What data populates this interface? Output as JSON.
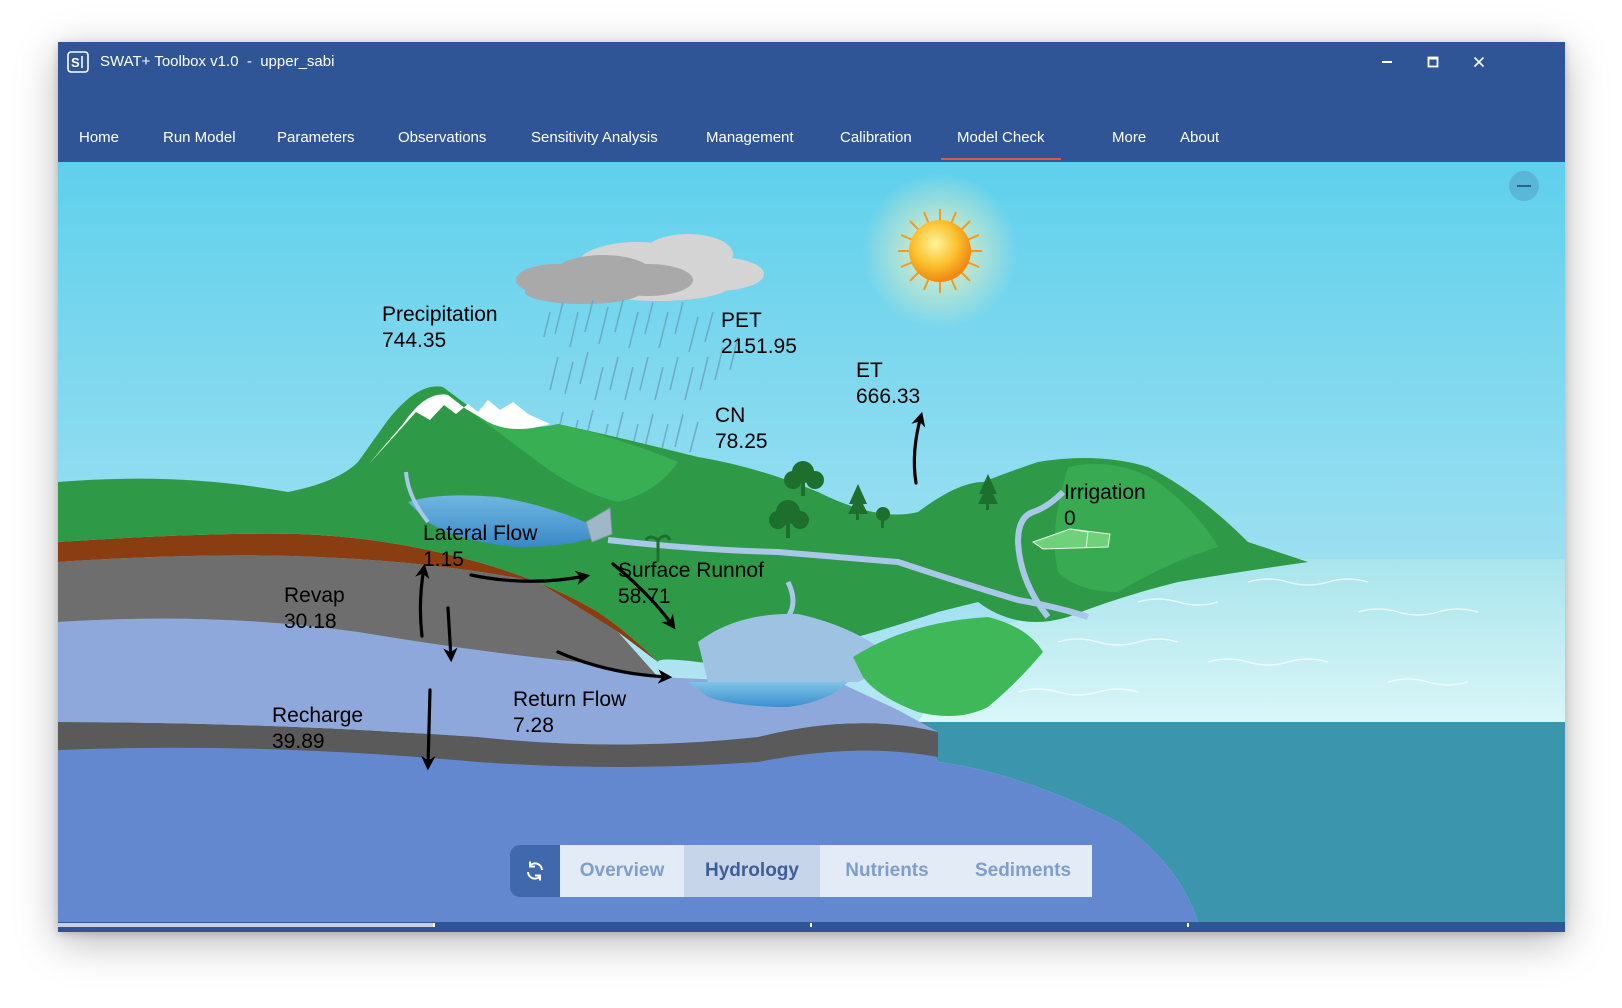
{
  "window": {
    "title": "SWAT+ Toolbox v1.0  -  upper_sabi",
    "app_icon": "swat-logo-icon",
    "controls": [
      "minimize-icon",
      "maximize-icon",
      "close-icon"
    ]
  },
  "menu": {
    "items": [
      {
        "label": "Home"
      },
      {
        "label": "Run Model"
      },
      {
        "label": "Parameters"
      },
      {
        "label": "Observations"
      },
      {
        "label": "Sensitivity Analysis"
      },
      {
        "label": "Management"
      },
      {
        "label": "Calibration"
      },
      {
        "label": "Model Check"
      },
      {
        "label": "More"
      },
      {
        "label": "About"
      }
    ],
    "active": "Model Check"
  },
  "hydrology": {
    "precipitation": {
      "label": "Precipitation",
      "value": "744.35"
    },
    "pet": {
      "label": "PET",
      "value": "2151.95"
    },
    "et": {
      "label": "ET",
      "value": "666.33"
    },
    "cn": {
      "label": "CN",
      "value": "78.25"
    },
    "irrigation": {
      "label": "Irrigation",
      "value": "0"
    },
    "lateral_flow": {
      "label": "Lateral Flow",
      "value": "1.15"
    },
    "surface_runoff": {
      "label": "Surface Runnof",
      "value": "58.71"
    },
    "revap": {
      "label": "Revap",
      "value": "30.18"
    },
    "recharge": {
      "label": "Recharge",
      "value": "39.89"
    },
    "return_flow": {
      "label": "Return Flow",
      "value": "7.28"
    }
  },
  "tabs": {
    "refresh_icon": "refresh-icon",
    "items": [
      {
        "label": "Overview"
      },
      {
        "label": "Hydrology"
      },
      {
        "label": "Nutrients"
      },
      {
        "label": "Sediments"
      }
    ],
    "active": "Hydrology"
  },
  "collapse_icon": "minus-icon",
  "colors": {
    "chrome": "#2f5597",
    "sky_top": "#5fd0ec",
    "sky_bottom": "#d8f1f7",
    "land": "#2e9a48",
    "soil": "#8b3d12",
    "rock": "#6e6e6e",
    "groundwater": "#8ea8dc",
    "deep_aquifer": "#6388cf",
    "sea": "#3b95ad",
    "accent": "#e0573f"
  }
}
